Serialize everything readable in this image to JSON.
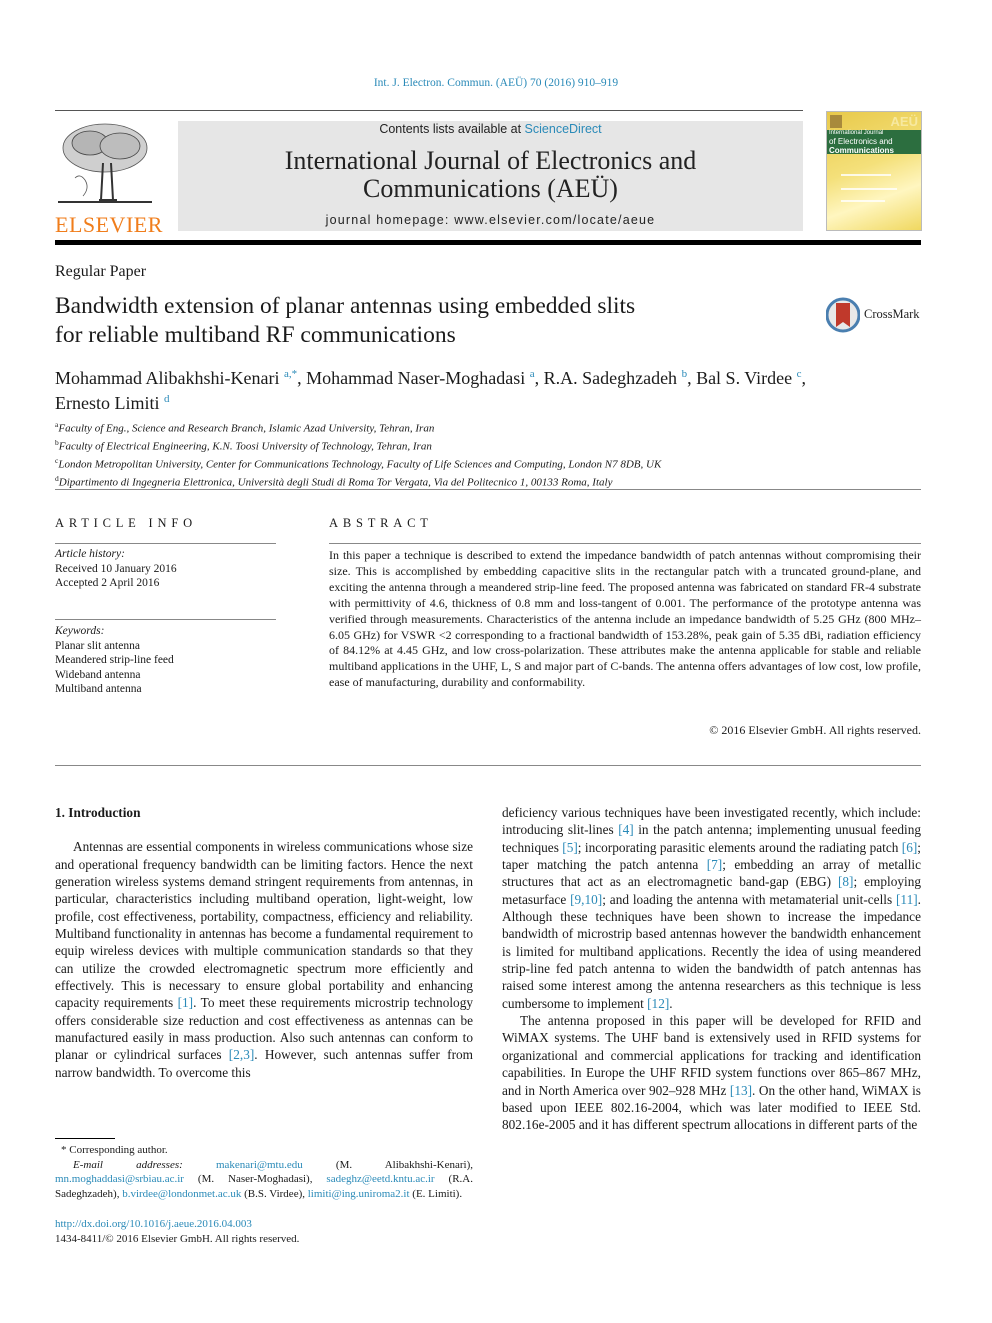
{
  "header": {
    "citation": "Int. J. Electron. Commun. (AEÜ) 70 (2016) 910–919",
    "contents_prefix": "Contents lists available at ",
    "contents_link": "ScienceDirect",
    "journal_title_line1": "International Journal of Electronics and",
    "journal_title_line2": "Communications (AEÜ)",
    "homepage": "journal homepage: www.elsevier.com/locate/aeue",
    "publisher_logo_text": "ELSEVIER",
    "cover": {
      "badge": "AEÜ",
      "line1": "International Journal",
      "line2": "of Electronics and",
      "line3": "Communications"
    },
    "colors": {
      "link": "#2a8ab8",
      "elsevier_orange": "#f07d1b",
      "cover_green": "#2c6e3f"
    }
  },
  "article": {
    "type": "Regular Paper",
    "title_line1": "Bandwidth extension of planar antennas using embedded slits",
    "title_line2": "for reliable multiband RF communications",
    "crossmark_label": "CrossMark",
    "authors": [
      {
        "name": "Mohammad Alibakhshi-Kenari",
        "sup": "a,*",
        "sep": ", "
      },
      {
        "name": "Mohammad Naser-Moghadasi",
        "sup": "a",
        "sep": ", "
      },
      {
        "name": "R.A. Sadeghzadeh",
        "sup": "b",
        "sep": ", "
      },
      {
        "name": "Bal S. Virdee",
        "sup": "c",
        "sep": ","
      },
      {
        "name": "Ernesto Limiti",
        "sup": "d",
        "sep": ""
      }
    ],
    "affiliations": [
      {
        "sup": "a",
        "text": "Faculty of Eng., Science and Research Branch, Islamic Azad University, Tehran, Iran"
      },
      {
        "sup": "b",
        "text": "Faculty of Electrical Engineering, K.N. Toosi University of Technology, Tehran, Iran"
      },
      {
        "sup": "c",
        "text": "London Metropolitan University, Center for Communications Technology, Faculty of Life Sciences and Computing, London N7 8DB, UK"
      },
      {
        "sup": "d",
        "text": "Dipartimento di Ingegneria Elettronica, Università degli Studi di Roma Tor Vergata, Via del Politecnico 1, 00133 Roma, Italy"
      }
    ]
  },
  "article_info": {
    "heading": "ARTICLE INFO",
    "history_label": "Article history:",
    "received": "Received 10 January 2016",
    "accepted": "Accepted 2 April 2016",
    "keywords_label": "Keywords:",
    "keywords": [
      "Planar slit antenna",
      "Meandered strip-line feed",
      "Wideband antenna",
      "Multiband antenna"
    ]
  },
  "abstract": {
    "heading": "ABSTRACT",
    "text": "In this paper a technique is described to extend the impedance bandwidth of patch antennas without compromising their size. This is accomplished by embedding capacitive slits in the rectangular patch with a truncated ground-plane, and exciting the antenna through a meandered strip-line feed. The proposed antenna was fabricated on standard FR-4 substrate with permittivity of 4.6, thickness of 0.8 mm and loss-tangent of 0.001. The performance of the prototype antenna was verified through measurements. Characteristics of the antenna include an impedance bandwidth of 5.25 GHz (800 MHz–6.05 GHz) for VSWR <2 corresponding to a fractional bandwidth of 153.28%, peak gain of 5.35 dBi, radiation efficiency of 84.12% at 4.45 GHz, and low cross-polarization. These attributes make the antenna applicable for stable and reliable multiband applications in the UHF, L, S and major part of C-bands. The antenna offers advantages of low cost, low profile, ease of manufacturing, durability and conformability.",
    "copyright": "© 2016 Elsevier GmbH. All rights reserved."
  },
  "body": {
    "section_heading": "1. Introduction",
    "left_p1": [
      "Antennas are essential components in wireless communications whose size and operational frequency bandwidth can be limiting factors. Hence the next generation wireless systems demand stringent requirements from antennas, in particular, characteristics including multiband operation, light-weight, low profile, cost effectiveness, portability, compactness, efficiency and reliability. Multiband functionality in antennas has become a fundamental requirement to equip wireless devices with multiple communication standards so that they can utilize the crowded electromagnetic spectrum more efficiently and effectively. This is necessary to ensure global portability and enhancing capacity requirements ",
      "[1]",
      ". To meet these requirements microstrip technology offers considerable size reduction and cost effectiveness as antennas can be manufactured easily in mass production. Also such antennas can conform to planar or cylindrical surfaces ",
      "[2,3]",
      ". However, such antennas suffer from narrow bandwidth. To overcome this"
    ],
    "right_p1": [
      "deficiency various techniques have been investigated recently, which include: introducing slit-lines ",
      "[4]",
      " in the patch antenna; implementing unusual feeding techniques ",
      "[5]",
      "; incorporating parasitic elements around the radiating patch ",
      "[6]",
      "; taper matching the patch antenna ",
      "[7]",
      "; embedding an array of metallic structures that act as an electromagnetic band-gap (EBG) ",
      "[8]",
      "; employing metasurface ",
      "[9,10]",
      "; and loading the antenna with metamaterial unit-cells ",
      "[11]",
      ". Although these techniques have been shown to increase the impedance bandwidth of microstrip based antennas however the bandwidth enhancement is limited for multiband applications. Recently the idea of using meandered strip-line fed patch antenna to widen the bandwidth of patch antennas has raised some interest among the antenna researchers as this technique is less cumbersome to implement ",
      "[12]",
      "."
    ],
    "right_p2": [
      "The antenna proposed in this paper will be developed for RFID and WiMAX systems. The UHF band is extensively used in RFID systems for organizational and commercial applications for tracking and identification capabilities. In Europe the UHF RFID system functions over 865–867 MHz, and in North America over 902–928 MHz ",
      "[13]",
      ". On the other hand, WiMAX is based upon IEEE 802.16-2004, which was later modified to IEEE Std. 802.16e-2005 and it has different spectrum allocations in different parts of the"
    ]
  },
  "footnotes": {
    "corresponding": "* Corresponding author.",
    "email_label": "E-mail addresses:",
    "emails": [
      {
        "addr": "makenari@mtu.edu",
        "who": " (M. Alibakhshi-Kenari), "
      },
      {
        "addr": "mn.moghaddasi@srbiau.ac.ir",
        "who": " (M. Naser-Moghadasi), "
      },
      {
        "addr": "sadeghz@eetd.kntu.ac.ir",
        "who": " (R.A. Sadeghzadeh), "
      },
      {
        "addr": "b.virdee@londonmet.ac.uk",
        "who": " (B.S. Virdee), "
      },
      {
        "addr": "limiti@ing.uniroma2.it",
        "who": " (E. Limiti)."
      }
    ],
    "doi": "http://dx.doi.org/10.1016/j.aeue.2016.04.003",
    "issn": "1434-8411/© 2016 Elsevier GmbH. All rights reserved."
  }
}
